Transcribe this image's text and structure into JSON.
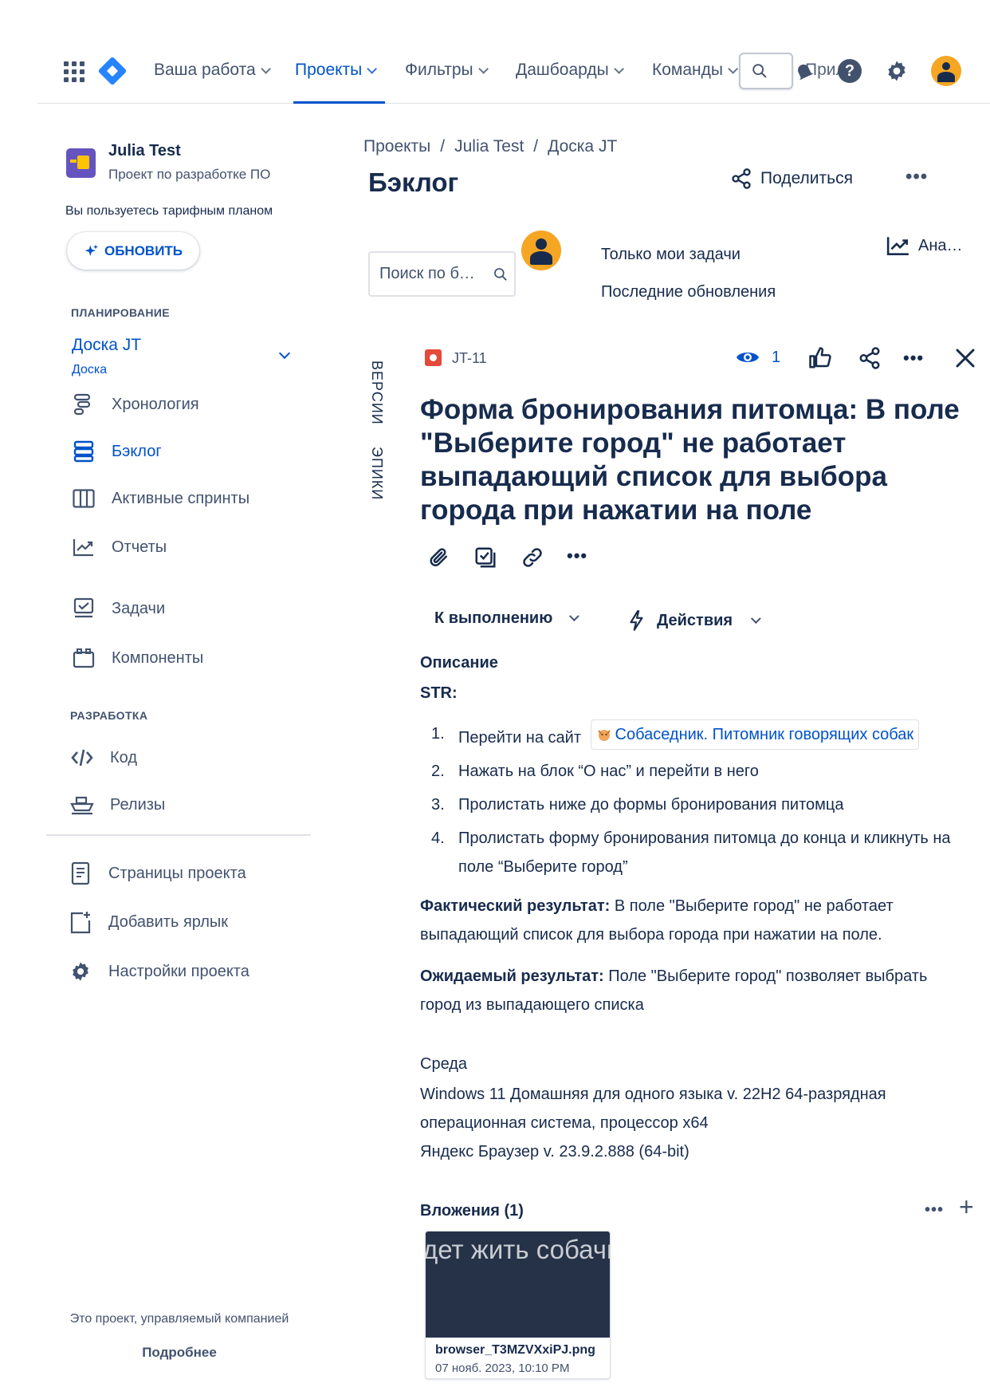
{
  "topnav": {
    "items": [
      {
        "label": "Ваша работа"
      },
      {
        "label": "Проекты"
      },
      {
        "label": "Фильтры"
      },
      {
        "label": "Дашбоарды"
      },
      {
        "label": "Команды"
      }
    ],
    "overflow_label": "Приложения",
    "accent": "#0052cc"
  },
  "sidebar": {
    "project_name": "Julia Test",
    "project_type": "Проект по разработке ПО",
    "plan_note": "Вы пользуетесь тарифным планом",
    "upgrade_label": "ОБНОВИТЬ",
    "planning_label": "ПЛАНИРОВАНИЕ",
    "board_name": "Доска JT",
    "board_sub": "Доска",
    "planning_items": [
      {
        "label": "Хронология",
        "icon": "timeline-icon"
      },
      {
        "label": "Бэклог",
        "icon": "backlog-icon"
      },
      {
        "label": "Активные спринты",
        "icon": "board-columns-icon"
      },
      {
        "label": "Отчеты",
        "icon": "chart-line-icon"
      },
      {
        "label": "Задачи",
        "icon": "issues-icon"
      },
      {
        "label": "Компоненты",
        "icon": "components-icon"
      }
    ],
    "dev_label": "РАЗРАБОТКА",
    "dev_items": [
      {
        "label": "Код",
        "icon": "code-icon"
      },
      {
        "label": "Релизы",
        "icon": "ship-icon"
      }
    ],
    "extra_items": [
      {
        "label": "Страницы проекта",
        "icon": "page-icon"
      },
      {
        "label": "Добавить ярлык",
        "icon": "add-shortcut-icon"
      },
      {
        "label": "Настройки проекта",
        "icon": "gear-icon"
      }
    ],
    "footer_note": "Это проект, управляемый компанией",
    "footer_link": "Подробнее"
  },
  "main": {
    "breadcrumb": [
      "Проекты",
      "Julia Test",
      "Доска JT"
    ],
    "title": "Бэклог",
    "share_label": "Поделиться",
    "search_placeholder": "Поиск по бэклогу",
    "filters": [
      "Только мои задачи",
      "Последние обновления"
    ],
    "insights_label": "Аналитика",
    "vertical_tabs": [
      "ВЕРСИИ",
      "ЭПИКИ"
    ]
  },
  "issue": {
    "key": "JT-11",
    "watchers": "1",
    "title": "Форма бронирования питомца: В поле \"Выберите город\" не работает выпадающий список для выбора города при нажатии на поле",
    "status": "К выполнению",
    "actions_label": "Действия",
    "description_label": "Описание",
    "str_label": "STR:",
    "steps": [
      {
        "num": "1.",
        "text": "Перейти на сайт",
        "link": "Собаседник. Питомник говорящих собак"
      },
      {
        "num": "2.",
        "text": "Нажать на блок “О нас” и перейти в него"
      },
      {
        "num": "3.",
        "text": "Пролистать ниже до формы бронирования питомца"
      },
      {
        "num": "4.",
        "text": "Пролистать форму бронирования питомца до конца и кликнуть на поле “Выберите город”"
      }
    ],
    "actual_label": "Фактический результат:",
    "actual_text": " В поле \"Выберите город\" не работает выпадающий список для выбора города при нажатии на поле.",
    "expected_label": "Ожидаемый результат:",
    "expected_text": " Поле \"Выберите город\" позволяет выбрать город из выпадающего списка",
    "env_label": "Среда",
    "env_lines": [
      "Windows 11 Домашняя для одного языка v. 22H2 64-разрядная операционная система, процессор x64",
      "Яндекс Браузер v. 23.9.2.888 (64-bit)"
    ],
    "attachments_label": "Вложения (1)",
    "attachment": {
      "thumb_text": "дет жить собачк",
      "filename": "browser_T3MZVXxiPJ.png",
      "date": "07 нояб. 2023, 10:10 PM"
    },
    "type_color": "#e5493a"
  }
}
